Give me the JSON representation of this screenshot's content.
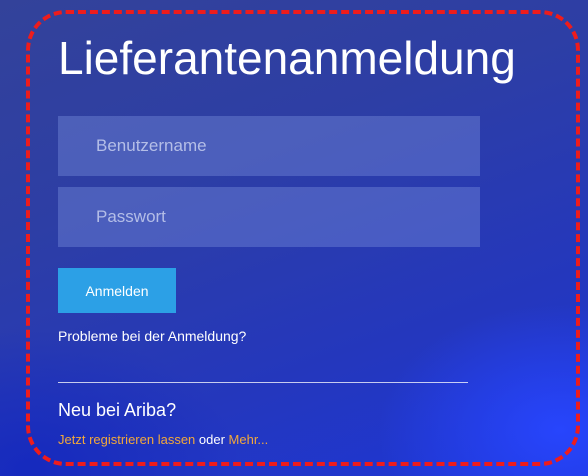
{
  "login": {
    "title": "Lieferantenanmeldung",
    "username_placeholder": "Benutzername",
    "password_placeholder": "Passwort",
    "submit_label": "Anmelden",
    "trouble_link": "Probleme bei der Anmeldung?"
  },
  "signup": {
    "heading": "Neu bei Ariba?",
    "register_link": "Jetzt registrieren lassen",
    "connector": " oder ",
    "more_link": "Mehr..."
  },
  "colors": {
    "button": "#2ca0e6",
    "link_accent": "#f2a83a",
    "highlight_frame": "#ee1c1c"
  }
}
